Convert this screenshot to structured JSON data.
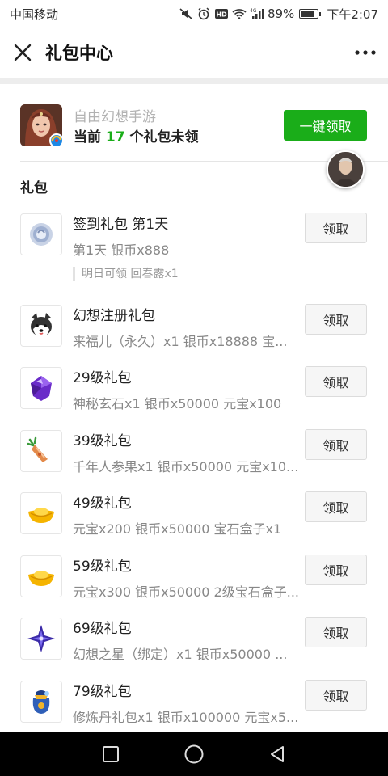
{
  "status_bar": {
    "carrier": "中国移动",
    "battery_percent": "89%",
    "battery_level": 0.89,
    "time": "下午2:07",
    "network": "4G"
  },
  "title_bar": {
    "title": "礼包中心",
    "close_icon": "close-icon",
    "more_icon": "more-icon"
  },
  "game": {
    "name": "自由幻想手游",
    "pending_prefix": "当前",
    "pending_count": "17",
    "pending_suffix": "个礼包未领",
    "claim_all_label": "一键领取"
  },
  "section_title": "礼包",
  "gifts": [
    {
      "name": "签到礼包 第1天",
      "desc": "第1天 银币x888",
      "note": "明日可领 回春露x1",
      "button": "领取",
      "icon": "silver-coin-icon"
    },
    {
      "name": "幻想注册礼包",
      "desc": "来福儿（永久）x1 银币x18888 宝...",
      "button": "领取",
      "icon": "husky-pet-icon"
    },
    {
      "name": "29级礼包",
      "desc": "神秘玄石x1 银币x50000 元宝x100",
      "button": "领取",
      "icon": "purple-gem-icon"
    },
    {
      "name": "39级礼包",
      "desc": "千年人参果x1 银币x50000 元宝x10...",
      "button": "领取",
      "icon": "ginseng-icon"
    },
    {
      "name": "49级礼包",
      "desc": "元宝x200 银币x50000 宝石盒子x1",
      "button": "领取",
      "icon": "gold-ingot-icon"
    },
    {
      "name": "59级礼包",
      "desc": "元宝x300 银币x50000 2级宝石盒子...",
      "button": "领取",
      "icon": "gold-ingot-icon"
    },
    {
      "name": "69级礼包",
      "desc": "幻想之星（绑定）x1 银币x50000 ...",
      "button": "领取",
      "icon": "fantasy-star-icon"
    },
    {
      "name": "79级礼包",
      "desc": "修炼丹礼包x1 银币x100000 元宝x5...",
      "button": "领取",
      "icon": "elixir-bag-icon"
    }
  ],
  "colors": {
    "accent": "#1aad19",
    "separator": "#ededed"
  }
}
